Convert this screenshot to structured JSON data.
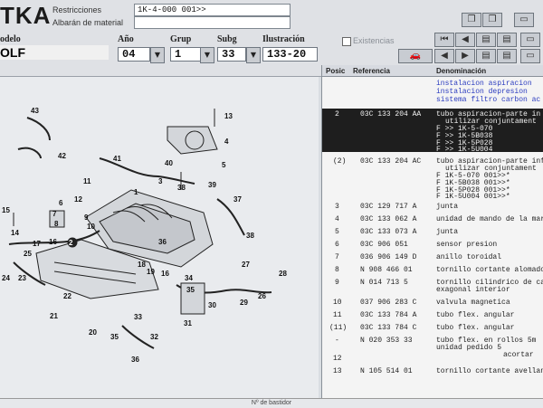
{
  "app": {
    "brand": "TKA"
  },
  "header": {
    "restricciones_label": "Restricciones",
    "restricciones_value": "1K-4-000 001>>",
    "albaran_label": "Albarán de material",
    "model_label": "odelo",
    "model_value": "OLF",
    "ano_label": "Año",
    "ano_value": "04",
    "grup_label": "Grup",
    "grup_value": "1",
    "subg_label": "Subg",
    "subg_value": "33",
    "ilustracion_label": "Ilustración",
    "ilustracion_value": "133-20",
    "existencias_label": "Existencias"
  },
  "table": {
    "columns": [
      "Posic",
      "Referencia",
      "Denominación"
    ],
    "intro_lines": [
      "instalacion aspiracion",
      "instalacion depresion",
      "sistema filtro carbon ac"
    ],
    "rows": [
      {
        "pos": "2",
        "ref": "03C 133 204 AA",
        "den": "tubo aspiracion-parte in",
        "extra": [
          "utilizar conjuntament",
          "F          >> 1K-5-070",
          "F          >> 1K-5B038",
          "F          >> 1K-5P028",
          "F          >> 1K-5U004"
        ],
        "highlight": true
      },
      {
        "pos": "(2)",
        "ref": "03C 133 204 AC",
        "den": "tubo aspiracion-parte inf",
        "extra": [
          "utilizar conjuntament",
          "F 1K-5-070 001>>*",
          "F 1K-5B038 001>>*",
          "F 1K-5P028 001>>*",
          "F 1K-5U004 001>>*"
        ],
        "highlight": false
      },
      {
        "pos": "3",
        "ref": "03C 129 717 A",
        "den": "junta",
        "extra": [],
        "highlight": false
      },
      {
        "pos": "4",
        "ref": "03C 133 062 A",
        "den": "unidad de mando de la mar",
        "extra": [],
        "highlight": false
      },
      {
        "pos": "5",
        "ref": "03C 133 073 A",
        "den": "junta",
        "extra": [],
        "highlight": false
      },
      {
        "pos": "6",
        "ref": "03C 906 051",
        "den": "sensor presion",
        "extra": [],
        "highlight": false
      },
      {
        "pos": "7",
        "ref": "036 906 149 D",
        "den": "anillo toroidal",
        "extra": [],
        "highlight": false
      },
      {
        "pos": "8",
        "ref": "N  908 466 01",
        "den": "tornillo cortante alomado",
        "extra": [],
        "highlight": false
      },
      {
        "pos": "9",
        "ref": "N  014 713 5",
        "den": "tornillo cilindrico de cab",
        "extra": [
          "exagonal interior"
        ],
        "highlight": false
      },
      {
        "pos": "10",
        "ref": "037 906 283 C",
        "den": "valvula magnetica",
        "extra": [],
        "highlight": false
      },
      {
        "pos": "11",
        "ref": "03C 133 784 A",
        "den": "tubo flex. angular",
        "extra": [],
        "highlight": false
      },
      {
        "pos": "(11)",
        "ref": "03C 133 784 C",
        "den": "tubo flex. angular",
        "extra": [],
        "highlight": false
      },
      {
        "pos": "-",
        "ref": "N  020 353 33",
        "den": "tubo flex. en rollos 5m",
        "extra": [
          "unidad pedido 5",
          "acortar"
        ],
        "highlight": false
      },
      {
        "pos": "12",
        "ref": "",
        "den": "",
        "extra": [],
        "highlight": false
      },
      {
        "pos": "13",
        "ref": "N  105 514 01",
        "den": "tornillo cortante avellana",
        "extra": [],
        "highlight": false
      }
    ]
  },
  "status": {
    "text": "Nº de bastidor"
  },
  "diagram": {
    "labels": [
      "43",
      "42",
      "41",
      "40",
      "39",
      "38",
      "37",
      "38",
      "36",
      "35",
      "34",
      "33",
      "32",
      "31",
      "30",
      "29",
      "28",
      "27",
      "26",
      "25",
      "24",
      "23",
      "22",
      "21",
      "20",
      "19",
      "18",
      "17",
      "16",
      "15",
      "14",
      "13",
      "12",
      "11",
      "10",
      "9",
      "8",
      "7",
      "6",
      "5",
      "4",
      "3",
      "2",
      "1"
    ]
  },
  "colors": {
    "accent": "#2a3bbf",
    "highlight": "#1e1e1e"
  }
}
